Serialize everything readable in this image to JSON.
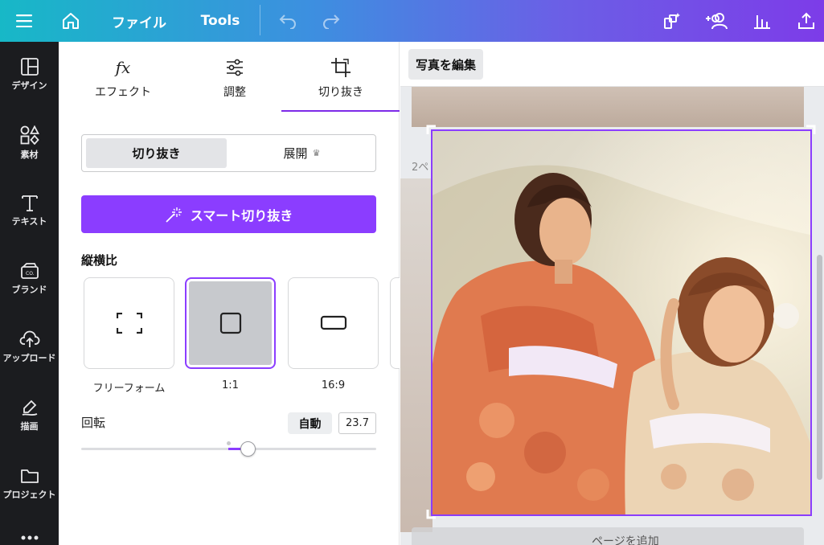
{
  "topbar": {
    "file_label": "ファイル",
    "tools_label": "Tools"
  },
  "leftnav": {
    "items": [
      {
        "label": "デザイン",
        "icon": "layout-icon"
      },
      {
        "label": "素材",
        "icon": "elements-icon"
      },
      {
        "label": "テキスト",
        "icon": "text-icon"
      },
      {
        "label": "ブランド",
        "icon": "brand-icon"
      },
      {
        "label": "アップロード",
        "icon": "upload-icon"
      },
      {
        "label": "描画",
        "icon": "draw-icon"
      },
      {
        "label": "プロジェクト",
        "icon": "folder-icon"
      }
    ]
  },
  "panel": {
    "tabs": [
      {
        "label": "エフェクト",
        "icon": "fx-icon"
      },
      {
        "label": "調整",
        "icon": "sliders-icon"
      },
      {
        "label": "切り抜き",
        "icon": "crop-icon",
        "active": true
      }
    ],
    "segment": {
      "active": "切り抜き",
      "other": "展開"
    },
    "smart_crop_label": "スマート切り抜き",
    "aspect_title": "縦横比",
    "ratios": [
      {
        "label": "フリーフォーム",
        "icon": "freeform-icon"
      },
      {
        "label": "1:1",
        "icon": "square-icon",
        "selected": true
      },
      {
        "label": "16:9",
        "icon": "wide-rect-icon"
      }
    ],
    "rotation": {
      "label": "回転",
      "auto_label": "自動",
      "value": "23.7"
    }
  },
  "canvas": {
    "edit_photo_label": "写真を編集",
    "page_label": "2ペ",
    "add_page_label": "ページを追加"
  },
  "colors": {
    "accent": "#8b3dff",
    "topbar_start": "#17b8c7",
    "topbar_end": "#7d3ce8",
    "nav_bg": "#1b1c1f"
  }
}
